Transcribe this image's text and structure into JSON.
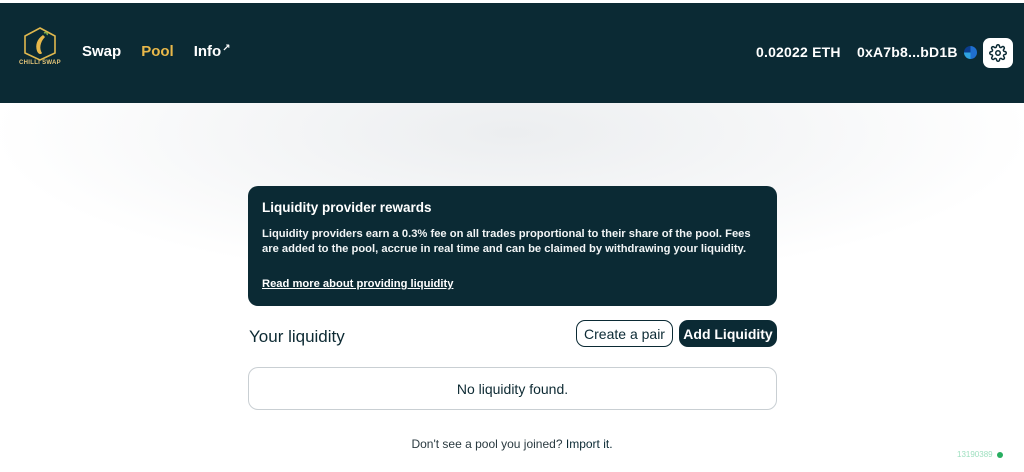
{
  "header": {
    "logo_text": "CHILLI SWAP",
    "nav": [
      {
        "label": "Swap",
        "active": false
      },
      {
        "label": "Pool",
        "active": true
      },
      {
        "label": "Info",
        "external_icon": "↗",
        "active": false
      }
    ],
    "balance": "0.02022 ETH",
    "account": "0xA7b8...bD1B",
    "settings_icon": "gear-icon"
  },
  "rewards": {
    "title": "Liquidity provider rewards",
    "body": "Liquidity providers earn a 0.3% fee on all trades proportional to their share of the pool. Fees are added to the pool, accrue in real time and can be claimed by withdrawing your liquidity.",
    "link": "Read more about providing liquidity"
  },
  "liquidity": {
    "heading": "Your liquidity",
    "create_pair": "Create a pair",
    "add_liquidity": "Add Liquidity",
    "empty_text": "No liquidity found."
  },
  "footer": {
    "import_prompt": "Don't see a pool you joined?",
    "import_link": "Import it.",
    "block_number": "13190389"
  },
  "colors": {
    "navy": "#0b2a34",
    "accent": "#e8b84a",
    "status_green": "#27ae60"
  }
}
